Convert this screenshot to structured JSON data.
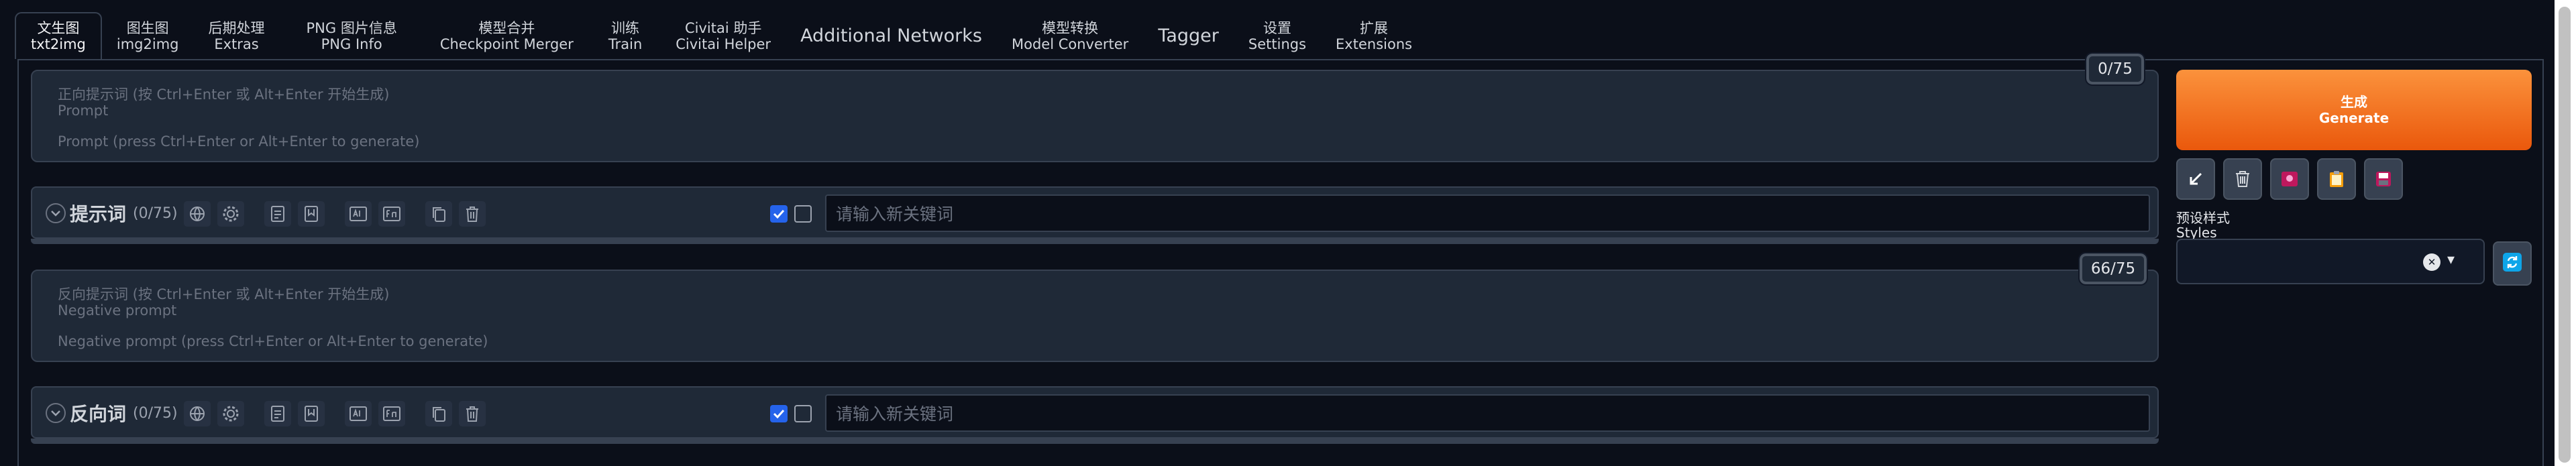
{
  "tabs": [
    {
      "zh": "文生图",
      "en": "txt2img",
      "active": true
    },
    {
      "zh": "图生图",
      "en": "img2img"
    },
    {
      "zh": "后期处理",
      "en": "Extras"
    },
    {
      "zh": "PNG 图片信息",
      "en": "PNG Info"
    },
    {
      "zh": "模型合并",
      "en": "Checkpoint Merger"
    },
    {
      "zh": "训练",
      "en": "Train"
    },
    {
      "zh": "Civitai 助手",
      "en": "Civitai Helper"
    },
    {
      "label": "Additional Networks"
    },
    {
      "zh": "模型转换",
      "en": "Model Converter"
    },
    {
      "label": "Tagger"
    },
    {
      "zh": "设置",
      "en": "Settings"
    },
    {
      "zh": "扩展",
      "en": "Extensions"
    }
  ],
  "prompt": {
    "token_count": "0/75",
    "placeholder_zh": "正向提示词 (按 Ctrl+Enter 或 Alt+Enter 开始生成)",
    "placeholder_label": "Prompt",
    "placeholder_en": "Prompt (press Ctrl+Enter or Alt+Enter to generate)"
  },
  "prompt_toolbar": {
    "title": "提示词",
    "count": "(0/75)",
    "keyword_placeholder": "请输入新关键词"
  },
  "negative_prompt": {
    "token_count": "66/75",
    "placeholder_zh": "反向提示词 (按 Ctrl+Enter 或 Alt+Enter 开始生成)",
    "placeholder_label": "Negative prompt",
    "placeholder_en": "Negative prompt (press Ctrl+Enter or Alt+Enter to generate)"
  },
  "negative_toolbar": {
    "title": "反向词",
    "count": "(0/75)",
    "keyword_placeholder": "请输入新关键词"
  },
  "generate": {
    "zh": "生成",
    "en": "Generate",
    "color": "#ea580c"
  },
  "tool_icons": [
    "arrow-icon",
    "trash-icon",
    "model-icon",
    "clipboard-icon",
    "save-icon"
  ],
  "styles": {
    "label_zh": "预设样式",
    "label_en": "Styles",
    "clear_glyph": "✕",
    "dropdown_glyph": "▾"
  },
  "accent": "#2563eb"
}
